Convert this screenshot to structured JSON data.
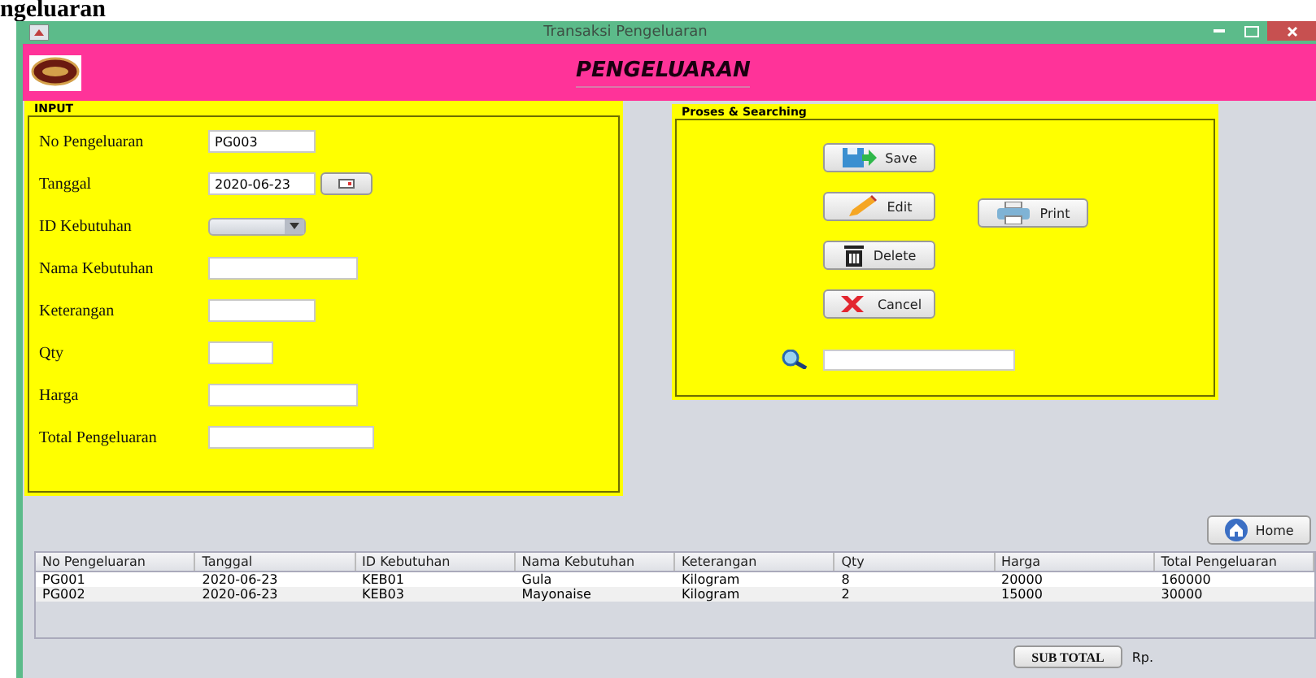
{
  "page_heading": "ngeluaran",
  "window": {
    "title": "Transaksi Pengeluaran"
  },
  "header": {
    "title": "PENGELUARAN"
  },
  "input_panel": {
    "title": "INPUT",
    "fields": [
      {
        "kind": "text",
        "label": "No Pengeluaran",
        "value": "PG003"
      },
      {
        "kind": "date",
        "label": "Tanggal",
        "value": "2020-06-23"
      },
      {
        "kind": "combo",
        "label": "ID Kebutuhan"
      },
      {
        "kind": "text",
        "label": "Nama Kebutuhan"
      },
      {
        "kind": "text",
        "label": "Keterangan"
      },
      {
        "kind": "text",
        "label": "Qty"
      },
      {
        "kind": "text",
        "label": "Harga"
      },
      {
        "kind": "text",
        "label": "Total Pengeluaran"
      }
    ]
  },
  "process_panel": {
    "title": "Proses & Searching",
    "buttons": [
      {
        "kind": "save",
        "label": "Save"
      },
      {
        "kind": "edit",
        "label": "Edit"
      },
      {
        "kind": "delete",
        "label": "Delete"
      },
      {
        "kind": "cancel",
        "label": "Cancel"
      }
    ],
    "print_button": "Print"
  },
  "home_button": "Home",
  "table": {
    "columns": [
      "No Pengeluaran",
      "Tanggal",
      "ID Kebutuhan",
      "Nama Kebutuhan",
      "Keterangan",
      "Qty",
      "Harga",
      "Total Pengeluaran"
    ],
    "rows": [
      [
        "PG001",
        "2020-06-23",
        "KEB01",
        "Gula",
        "Kilogram",
        "8",
        "20000",
        "160000"
      ],
      [
        "PG002",
        "2020-06-23",
        "KEB03",
        "Mayonaise",
        "Kilogram",
        "2",
        "15000",
        "30000"
      ]
    ]
  },
  "sub_total_button": "SUB TOTAL",
  "currency": "Rp."
}
